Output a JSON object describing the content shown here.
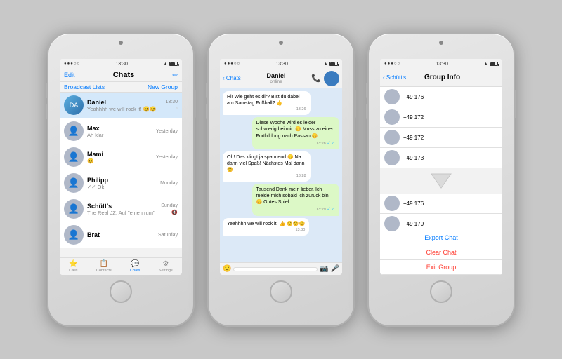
{
  "phone1": {
    "statusBar": {
      "signal": "●●●○○",
      "carrier": "▲▲▲",
      "time": "13:30",
      "wifi": "WiFi",
      "battery": "70"
    },
    "nav": {
      "edit": "Edit",
      "title": "Chats",
      "compose": "✏"
    },
    "subbar": {
      "broadcastLists": "Broadcast Lists",
      "newGroup": "New Group"
    },
    "chats": [
      {
        "name": "Daniel",
        "preview": "Yeahhhh we will rock it! 😊😊",
        "time": "13:30",
        "active": true
      },
      {
        "name": "Max",
        "preview": "Ah klar",
        "time": "Yesterday",
        "active": false
      },
      {
        "name": "Mami",
        "preview": "😊",
        "time": "Yesterday",
        "active": false
      },
      {
        "name": "Philipp",
        "preview": "✓✓ Ok",
        "time": "Monday",
        "active": false
      },
      {
        "name": "Schütt's",
        "preview": "The Real JZ: Auf \"einen rum\"",
        "time": "Sunday",
        "active": false
      },
      {
        "name": "Brat",
        "preview": "",
        "time": "Saturday",
        "active": false
      }
    ],
    "tabs": [
      "Favorites",
      "Calls",
      "Contacts",
      "Chats",
      "Settings"
    ]
  },
  "phone2": {
    "nav": {
      "back": "< Chats",
      "name": "Daniel",
      "status": "online"
    },
    "messages": [
      {
        "text": "Hi! Wie geht es dir? Bist du dabei am Samstag Fußball? 👍",
        "type": "received",
        "time": "13:26"
      },
      {
        "text": "Diese Woche wird es leider schwierig bei mir. 😊 Muss zu einer Fortbildung nach Passau 😊",
        "type": "sent",
        "time": "13:28",
        "check": "✓✓"
      },
      {
        "text": "Oh! Das klingt ja spannend 😊 Na dann viel Spaß! Nächstes Mal dann 😊",
        "type": "received",
        "time": "13:28"
      },
      {
        "text": "Tausend Dank mein lieber. Ich melde mich sobald ich zurück bin. 😊 Gutes Spiel",
        "type": "sent",
        "time": "13:29",
        "check": "✓✓"
      },
      {
        "text": "Yeahhhh we will rock it! 👍 😊😊😊",
        "type": "received",
        "time": "13:30"
      }
    ],
    "inputPlaceholder": ""
  },
  "phone3": {
    "nav": {
      "back": "< Schütt's",
      "title": "Group Info"
    },
    "members": [
      "+49 176",
      "+49 172",
      "+49 172",
      "+49 173",
      "+49 176",
      "+49 179"
    ],
    "actions": [
      {
        "label": "Export Chat",
        "type": "blue"
      },
      {
        "label": "Clear Chat",
        "type": "red"
      },
      {
        "label": "Exit Group",
        "type": "red"
      }
    ]
  }
}
